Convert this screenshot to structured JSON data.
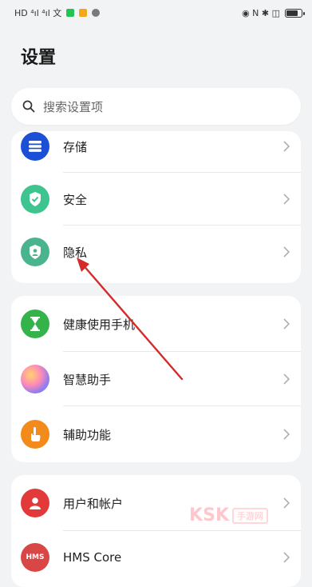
{
  "status_bar": {
    "left_glyphs": "HD ⁴ıl ⁴ıl 文",
    "right_glyphs": "◉ N ✱ ◫"
  },
  "page": {
    "title": "设置"
  },
  "search": {
    "placeholder": "搜索设置项"
  },
  "groups": [
    {
      "items": [
        {
          "label": "存储"
        },
        {
          "label": "安全"
        },
        {
          "label": "隐私"
        }
      ]
    },
    {
      "items": [
        {
          "label": "健康使用手机"
        },
        {
          "label": "智慧助手"
        },
        {
          "label": "辅助功能"
        }
      ]
    },
    {
      "items": [
        {
          "label": "用户和帐户"
        },
        {
          "label": "HMS Core",
          "icon_text": "HMS"
        }
      ]
    }
  ],
  "watermark": {
    "brand": "KSK",
    "site": "手游网"
  },
  "colors": {
    "storage": "#1a4fd6",
    "security": "#3ec48f",
    "privacy": "#4ab48f",
    "health": "#33b34a",
    "assistant": "#8f7cf0",
    "accessibility": "#f28a1c",
    "account": "#e23a3a",
    "hms": "#d94646",
    "annotation_arrow": "#d42a2a"
  }
}
